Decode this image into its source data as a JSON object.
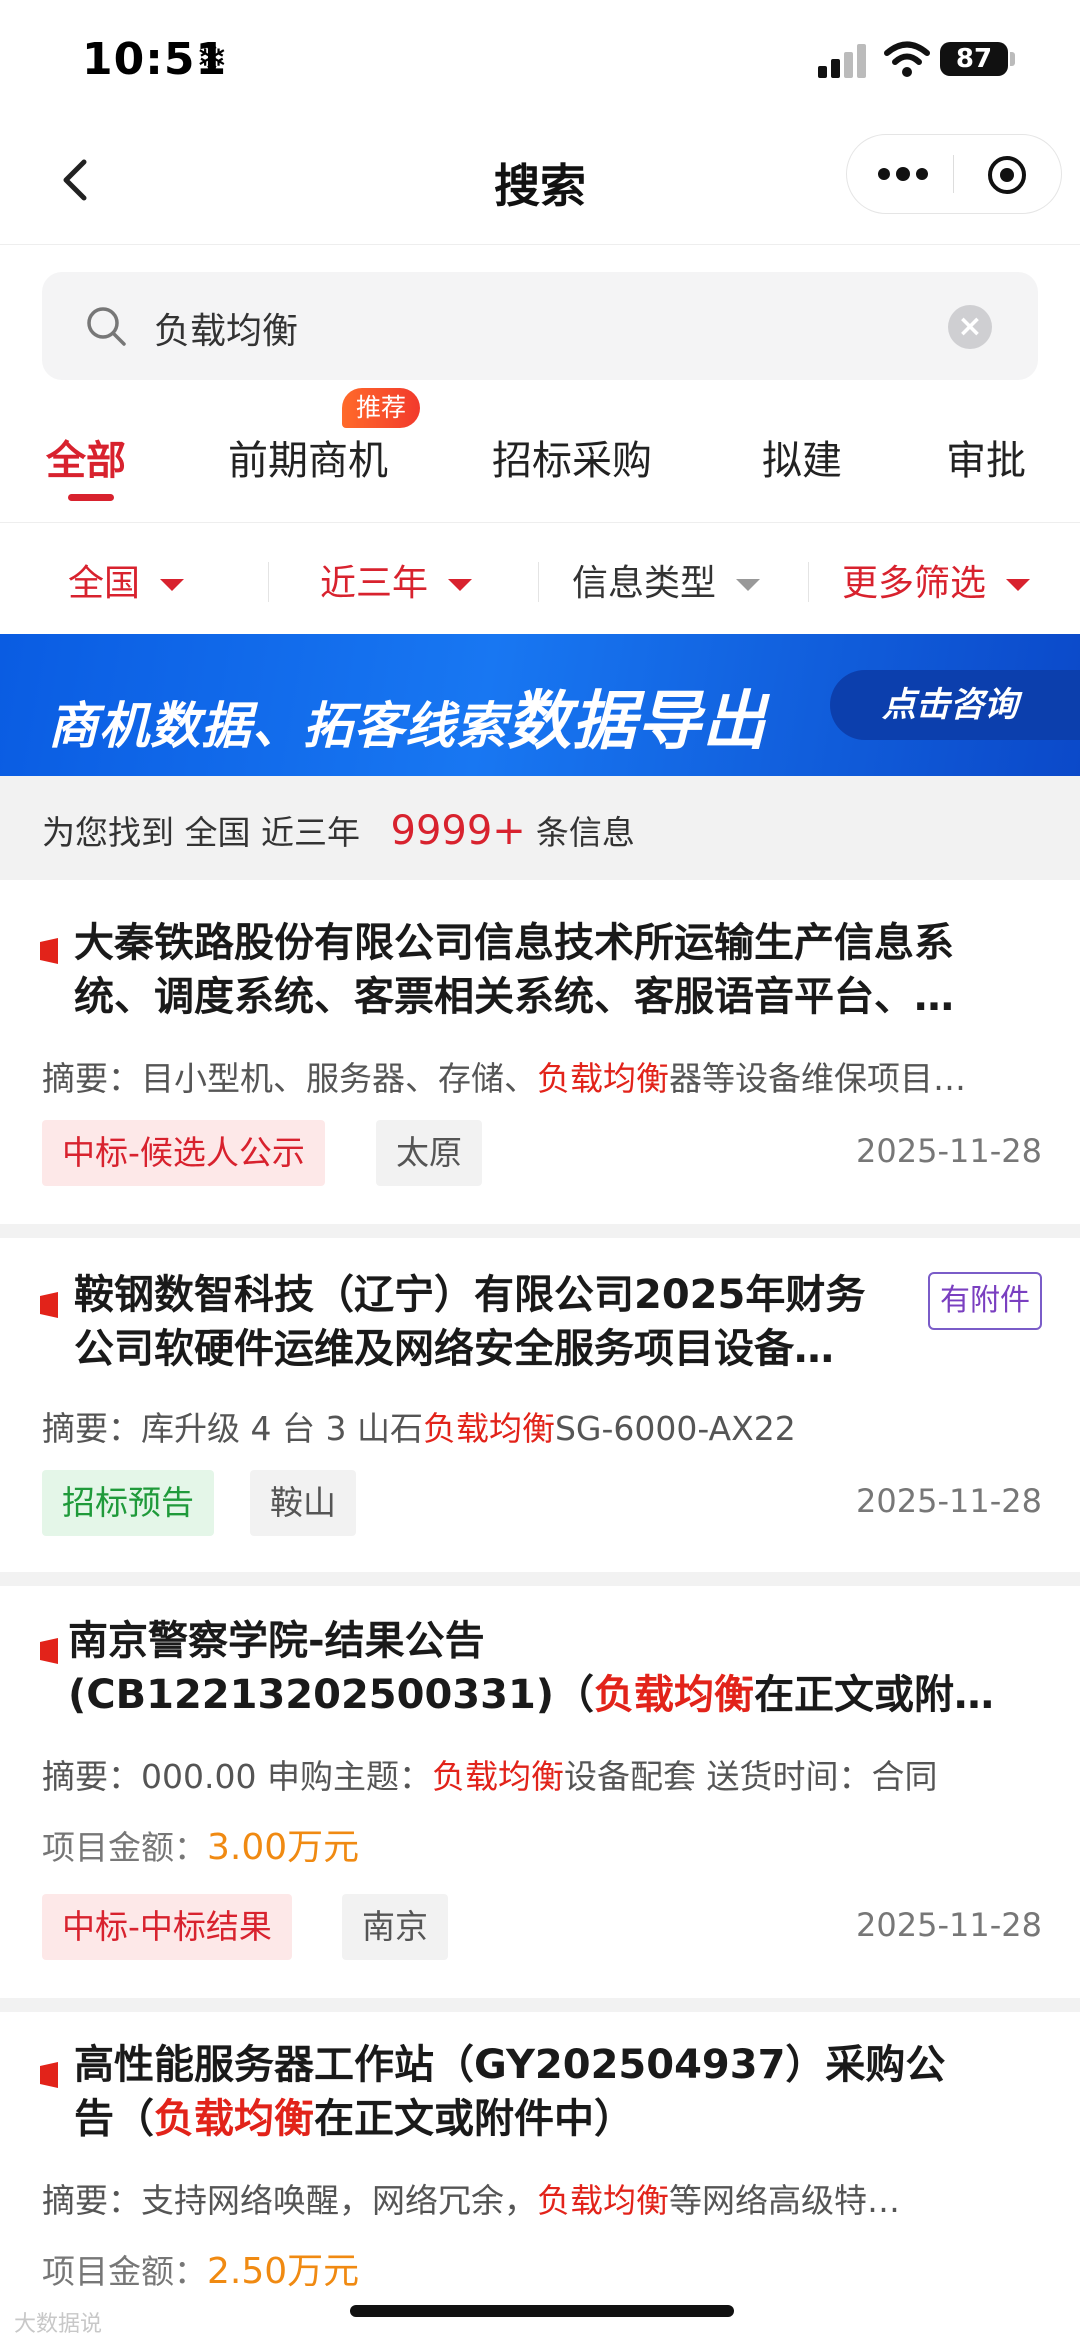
{
  "status": {
    "time": "10:51",
    "battery": "87"
  },
  "nav": {
    "title": "搜索"
  },
  "search": {
    "query": "负载均衡"
  },
  "tabs": [
    {
      "label": "全部"
    },
    {
      "label": "前期商机",
      "badge": "推荐"
    },
    {
      "label": "招标采购"
    },
    {
      "label": "拟建"
    },
    {
      "label": "审批"
    }
  ],
  "filters": [
    {
      "label": "全国"
    },
    {
      "label": "近三年"
    },
    {
      "label": "信息类型"
    },
    {
      "label": "更多筛选"
    }
  ],
  "banner": {
    "text_a": "商机数据、拓客线索",
    "text_b": "数据导出",
    "cta": "点击咨询"
  },
  "summary": {
    "prefix": "为您找到",
    "region": "全国",
    "period": "近三年",
    "count": "9999+",
    "suffix": "条信息"
  },
  "results": [
    {
      "title_line1": "大秦铁路股份有限公司信息技术所运输生产信息系",
      "title_line2": "统、调度系统、客票相关系统、客服语音平台、…",
      "abstract_label": "摘要：",
      "abstract_pre": "目小型机、服务器、存储、",
      "abstract_hl": "负载均衡",
      "abstract_post": "器等设备维保项目…",
      "tag_type": "中标-候选人公示",
      "tag_city": "太原",
      "date": "2025-11-28"
    },
    {
      "title_line1": "鞍钢数智科技（辽宁）有限公司2025年财务",
      "title_line2": "公司软硬件运维及网络安全服务项目设备…",
      "attachment": "有附件",
      "abstract_label": "摘要：",
      "abstract_pre": "库升级 4 台 3 山石",
      "abstract_hl": "负载均衡",
      "abstract_post": "SG-6000-AX22",
      "tag_type": "招标预告",
      "tag_city": "鞍山",
      "date": "2025-11-28"
    },
    {
      "title_line1": "南京警察学院-结果公告",
      "title_line2_pre": "(CB12213202500331)（",
      "title_line2_hl": "负载均衡",
      "title_line2_post": "在正文或附…",
      "abstract_label": "摘要：",
      "abstract_pre": "000.00 申购主题：",
      "abstract_hl": "负载均衡",
      "abstract_post": "设备配套 送货时间：合同",
      "amount_label": "项目金额：",
      "amount": "3.00万元",
      "tag_type": "中标-中标结果",
      "tag_city": "南京",
      "date": "2025-11-28"
    },
    {
      "title_line1": "高性能服务器工作站（GY202504937）采购公",
      "title_line2_pre": "告（",
      "title_line2_hl": "负载均衡",
      "title_line2_post": "在正文或附件中）",
      "abstract_label": "摘要：",
      "abstract_pre": "支持网络唤醒，网络冗余，",
      "abstract_hl": "负载均衡",
      "abstract_post": "等网络高级特…",
      "amount_label": "项目金额：",
      "amount": "2.50万元"
    }
  ],
  "watermark": "大数据说"
}
